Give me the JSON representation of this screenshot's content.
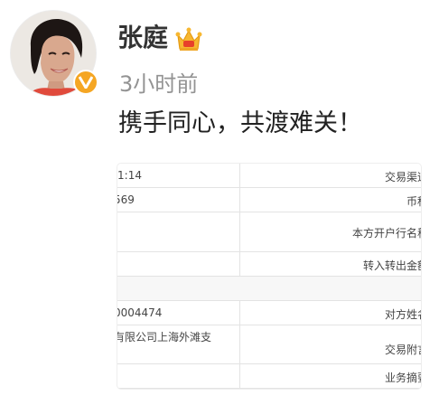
{
  "post": {
    "user_name": "张庭",
    "time": "3小时前",
    "text": "携手同心，共渡难关！",
    "avatar_icon": "avatar-photo",
    "verified_icon": "verified-v-badge",
    "member_icon": "crown-icon",
    "badge_letter": "V"
  },
  "colors": {
    "badge": "#f5a623",
    "crown": "#e8402a",
    "name": "#333333",
    "time": "#939393"
  },
  "image": {
    "rows": [
      {
        "left": ":1:14",
        "right": "交易渠道"
      },
      {
        "left": "569",
        "right": "币种"
      },
      {
        "left": "",
        "right": "本方开户行名称"
      },
      {
        "left": "",
        "right": "转入转出金额"
      },
      {
        "left": "",
        "right": ""
      },
      {
        "left": "0004474",
        "right": "对方姓名"
      },
      {
        "left": "有限公司上海外滩支",
        "right": "交易附言"
      },
      {
        "left": "",
        "right": "业务摘要"
      }
    ]
  }
}
